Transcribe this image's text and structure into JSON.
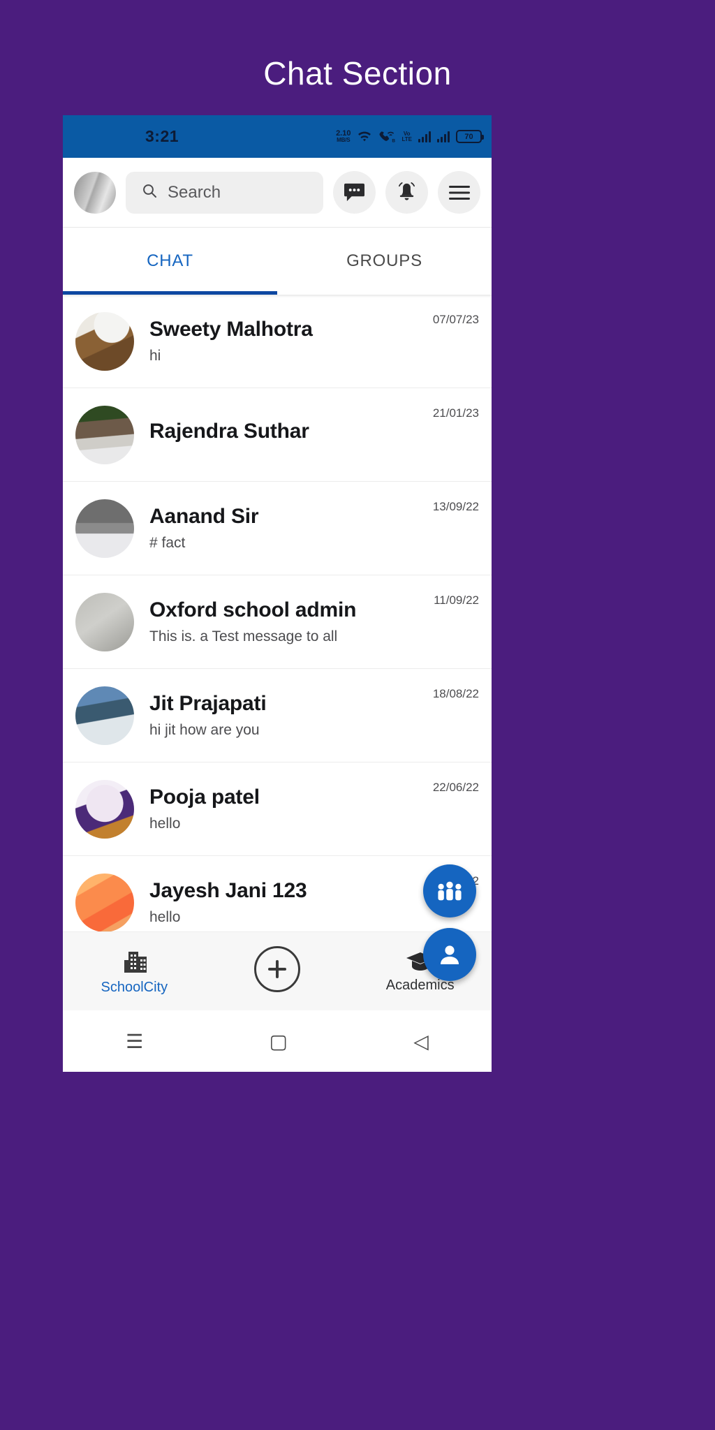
{
  "heading": "Chat Section",
  "status_bar": {
    "time": "3:21",
    "net_speed_value": "2.10",
    "net_speed_unit": "MB/S",
    "volte_line1": "Vo",
    "volte_line2": "LTE",
    "battery_level": "70",
    "icons": [
      "wifi-icon",
      "missed-call-icon",
      "volte-icon",
      "signal-bars-icon",
      "signal-bars-icon",
      "battery-icon"
    ]
  },
  "toolbar": {
    "avatar": "user-avatar",
    "search_placeholder": "Search",
    "search_value": "",
    "search_icon": "search-icon",
    "message_icon": "chat-bubble-icon",
    "notification_icon": "bell-icon",
    "menu_icon": "hamburger-menu-icon"
  },
  "tabs": [
    {
      "label": "CHAT",
      "active": true
    },
    {
      "label": "GROUPS",
      "active": false
    }
  ],
  "chats": [
    {
      "name": "Sweety Malhotra",
      "message": "hi",
      "date": "07/07/23",
      "avatar_class": "av-sweety"
    },
    {
      "name": "Rajendra Suthar",
      "message": "",
      "date": "21/01/23",
      "avatar_class": "av-rajendra"
    },
    {
      "name": "Aanand Sir",
      "message": "# fact",
      "date": "13/09/22",
      "avatar_class": "av-aanand"
    },
    {
      "name": "Oxford school admin",
      "message": "This is. a Test message to all",
      "date": "11/09/22",
      "avatar_class": "av-oxford"
    },
    {
      "name": "Jit Prajapati",
      "message": "hi jit how are you",
      "date": "18/08/22",
      "avatar_class": "av-jit"
    },
    {
      "name": "Pooja patel",
      "message": "hello",
      "date": "22/06/22",
      "avatar_class": "av-pooja"
    },
    {
      "name": "Jayesh Jani 123",
      "message": "hello",
      "date": "22/06/22",
      "avatar_class": "av-jayesh"
    }
  ],
  "fabs": [
    {
      "name": "group-chat-fab",
      "icon": "group-people-icon"
    },
    {
      "name": "new-chat-fab",
      "icon": "single-person-icon"
    }
  ],
  "bottom_nav": [
    {
      "label": "SchoolCity",
      "icon": "building-icon"
    },
    {
      "label": "",
      "icon": "plus-circle-icon"
    },
    {
      "label": "Academics",
      "icon": "graduation-cap-icon"
    }
  ],
  "android_nav": [
    {
      "name": "recents-button",
      "glyph": "☰"
    },
    {
      "name": "home-button",
      "glyph": "▢"
    },
    {
      "name": "back-button",
      "glyph": "◁"
    }
  ],
  "colors": {
    "backdrop": "#4B1D7E",
    "status_bar": "#0A5AA4",
    "accent": "#1565C0",
    "tab_indicator": "#0D47A1"
  }
}
